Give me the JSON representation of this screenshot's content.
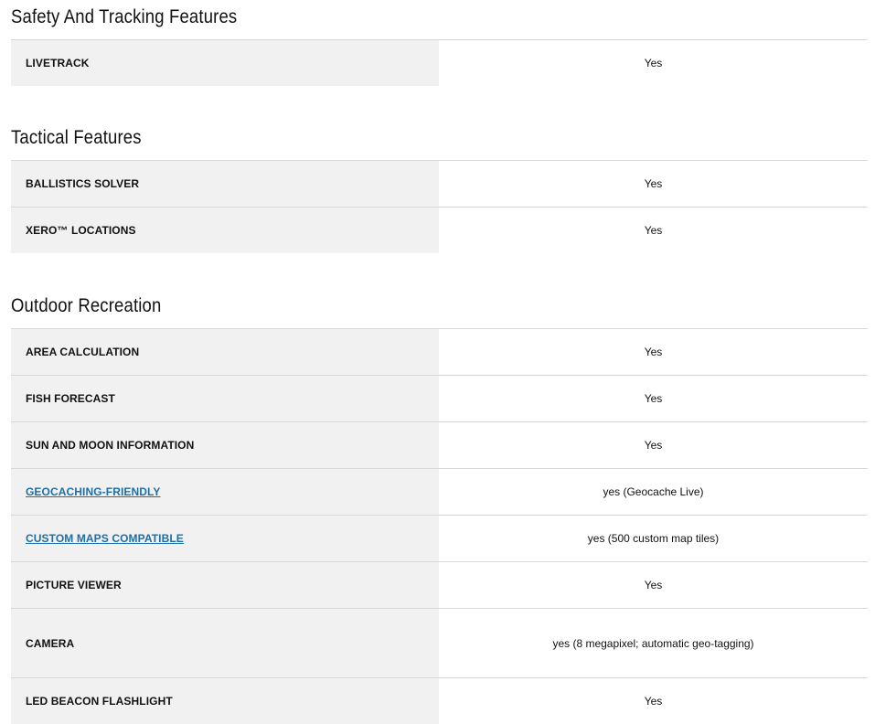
{
  "sections": [
    {
      "title": "Safety And Tracking Features",
      "rows": [
        {
          "label": "LIVETRACK",
          "value": "Yes"
        }
      ]
    },
    {
      "title": "Tactical Features",
      "rows": [
        {
          "label": "BALLISTICS SOLVER",
          "value": "Yes"
        },
        {
          "label": "XERO™ LOCATIONS",
          "value": "Yes"
        }
      ]
    },
    {
      "title": "Outdoor Recreation",
      "rows": [
        {
          "label": "AREA CALCULATION",
          "value": "Yes"
        },
        {
          "label": "FISH FORECAST",
          "value": "Yes"
        },
        {
          "label": "SUN AND MOON INFORMATION",
          "value": "Yes"
        },
        {
          "label": "GEOCACHING-FRIENDLY",
          "value": "yes (Geocache Live)"
        },
        {
          "label": "CUSTOM MAPS COMPATIBLE",
          "value": "yes (500 custom map tiles)"
        },
        {
          "label": "PICTURE VIEWER",
          "value": "Yes"
        },
        {
          "label": "CAMERA",
          "value": "yes (8 megapixel; automatic geo-tagging)"
        },
        {
          "label": "LED BEACON FLASHLIGHT",
          "value": "Yes"
        }
      ]
    }
  ],
  "colors": {
    "label_bg": "#f1f1f1",
    "divider": "#d8d8d8",
    "link": "#1d6fa5"
  }
}
